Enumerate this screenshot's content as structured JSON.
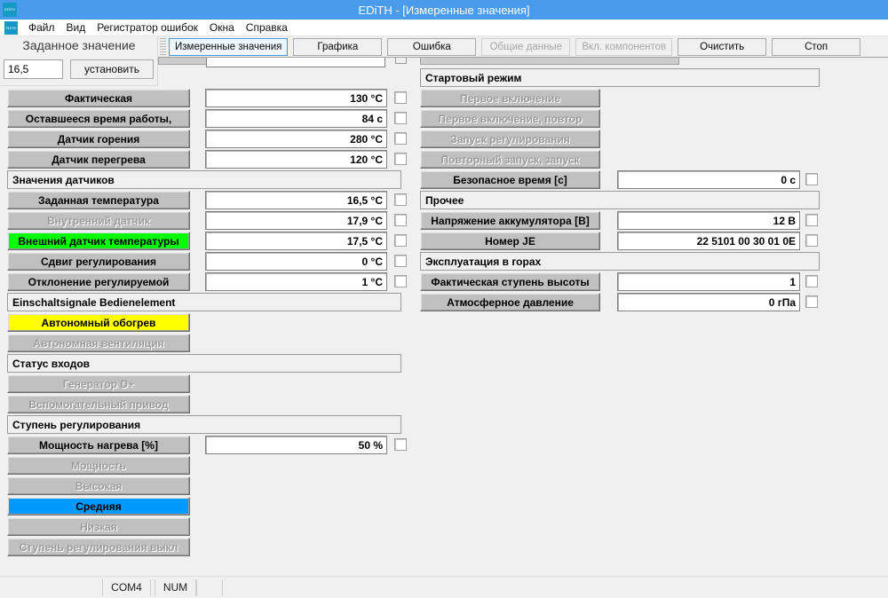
{
  "window": {
    "title": "EDiTH - [Измеренные значения]",
    "app_icon": "edith-app-icon"
  },
  "menubar": {
    "icon": "edith-menu-icon",
    "items": [
      {
        "label": "Файл"
      },
      {
        "label": "Вид"
      },
      {
        "label": "Регистратор ошибок"
      },
      {
        "label": "Окна"
      },
      {
        "label": "Справка"
      }
    ]
  },
  "setpoint_panel": {
    "title": "Заданное значение",
    "input_value": "16,5",
    "input_placeholder": "",
    "button_label": "установить"
  },
  "tabs": [
    {
      "label": "Измеренные значения",
      "state": "active"
    },
    {
      "label": "Графика",
      "state": "normal"
    },
    {
      "label": "Ошибка",
      "state": "normal"
    },
    {
      "label": "Общие данные",
      "state": "disabled"
    },
    {
      "label": "Вкл. компонентов",
      "state": "disabled"
    },
    {
      "label": "Очистить",
      "state": "normal"
    },
    {
      "label": "Стоп",
      "state": "normal"
    }
  ],
  "clipped_top_row": {
    "value_left": "",
    "value_right": ""
  },
  "left_column": [
    {
      "kind": "value",
      "label": "Фактическая",
      "state": "on",
      "value": "130 °C",
      "checked": false
    },
    {
      "kind": "value",
      "label": "Оставшееся время работы,",
      "state": "on",
      "value": "84 c",
      "checked": false
    },
    {
      "kind": "value",
      "label": "Датчик горения",
      "state": "on",
      "value": "280 °C",
      "checked": false
    },
    {
      "kind": "value",
      "label": "Датчик перегрева",
      "state": "on",
      "value": "120 °C",
      "checked": false
    },
    {
      "kind": "group",
      "label": "Значения датчиков"
    },
    {
      "kind": "value",
      "label": "Заданная температура",
      "state": "on",
      "value": "16,5 °C",
      "checked": false
    },
    {
      "kind": "value",
      "label": "Внутренний датчик",
      "state": "off",
      "value": "17,9 °C",
      "checked": false
    },
    {
      "kind": "value",
      "label": "Внешний датчик температуры",
      "state": "green",
      "value": "17,5 °C",
      "checked": false
    },
    {
      "kind": "value",
      "label": "Сдвиг регулирования",
      "state": "on",
      "value": "0 °C",
      "checked": false
    },
    {
      "kind": "value",
      "label": "Отклонение регулируемой",
      "state": "on",
      "value": "1 °C",
      "checked": false
    },
    {
      "kind": "group",
      "label": "Einschaltsignale Bedienelement"
    },
    {
      "kind": "indicator",
      "label": "Автономный обогрев",
      "state": "yellow"
    },
    {
      "kind": "indicator",
      "label": "Автономная вентиляция",
      "state": "off"
    },
    {
      "kind": "group",
      "label": "Статус входов"
    },
    {
      "kind": "indicator",
      "label": "Генератор D+",
      "state": "off"
    },
    {
      "kind": "indicator",
      "label": "Вспомогательный привод",
      "state": "off"
    },
    {
      "kind": "group",
      "label": "Ступень регулирования"
    },
    {
      "kind": "value",
      "label": "Мощность нагрева [%]",
      "state": "on",
      "value": "50 %",
      "checked": false
    },
    {
      "kind": "indicator",
      "label": "Мощность",
      "state": "off"
    },
    {
      "kind": "indicator",
      "label": "Высокая",
      "state": "off"
    },
    {
      "kind": "indicator",
      "label": "Средняя",
      "state": "blue"
    },
    {
      "kind": "indicator",
      "label": "Низкая",
      "state": "off"
    },
    {
      "kind": "indicator",
      "label": "Ступень регулирования выкл",
      "state": "off"
    }
  ],
  "right_column": [
    {
      "kind": "group",
      "label": "Стартовый режим"
    },
    {
      "kind": "indicator",
      "label": "Первое включение",
      "state": "off"
    },
    {
      "kind": "indicator",
      "label": "Первое включение, повтор",
      "state": "off"
    },
    {
      "kind": "indicator",
      "label": "Запуск регулирования",
      "state": "off"
    },
    {
      "kind": "indicator",
      "label": "Повторный запуск, запуск",
      "state": "off"
    },
    {
      "kind": "value",
      "label": "Безопасное время [c]",
      "state": "on",
      "value": "0 c",
      "checked": false
    },
    {
      "kind": "group",
      "label": "Прочее"
    },
    {
      "kind": "value",
      "label": "Напряжение аккумулятора [В]",
      "state": "on",
      "value": "12 В",
      "checked": false
    },
    {
      "kind": "value",
      "label": "Номер JE",
      "state": "on",
      "value": "22 5101 00 30 01 0E",
      "checked": false
    },
    {
      "kind": "group",
      "label": "Эксплуатация в горах"
    },
    {
      "kind": "value",
      "label": "Фактическая ступень высоты",
      "state": "on",
      "value": "1",
      "checked": false
    },
    {
      "kind": "value",
      "label": "Атмосферное давление",
      "state": "on",
      "value": "0 гПа",
      "checked": false
    }
  ],
  "statusbar": {
    "com_port": "COM4",
    "num_lock": "NUM"
  },
  "colors": {
    "titlebar": "#4b9bec",
    "accent_active_tab_border": "#4d97d4",
    "indicator_green": "#00ff00",
    "indicator_yellow": "#ffff00",
    "indicator_blue": "#0099ff",
    "button_face": "#c0c0c0",
    "window_face": "#f0f0f0"
  }
}
